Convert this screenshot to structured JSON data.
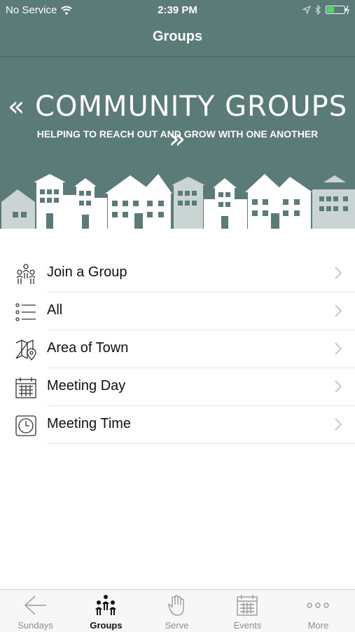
{
  "status_bar": {
    "carrier": "No Service",
    "time": "2:39 PM"
  },
  "nav": {
    "title": "Groups"
  },
  "banner": {
    "title": "« COMMUNITY GROUPS »",
    "subtitle": "HELPING TO REACH OUT AND GROW WITH ONE ANOTHER"
  },
  "menu": {
    "items": [
      {
        "label": "Join a Group",
        "icon": "people-group-icon"
      },
      {
        "label": "All",
        "icon": "list-icon"
      },
      {
        "label": "Area of Town",
        "icon": "map-pin-icon"
      },
      {
        "label": "Meeting Day",
        "icon": "calendar-icon"
      },
      {
        "label": "Meeting Time",
        "icon": "clock-icon"
      }
    ]
  },
  "tabbar": {
    "tabs": [
      {
        "label": "Sundays",
        "icon": "back-arrow-icon"
      },
      {
        "label": "Groups",
        "icon": "groups-icon",
        "active": true
      },
      {
        "label": "Serve",
        "icon": "hand-icon"
      },
      {
        "label": "Events",
        "icon": "calendar-icon"
      },
      {
        "label": "More",
        "icon": "more-dots-icon"
      }
    ]
  },
  "colors": {
    "accent": "#5b7b78"
  }
}
